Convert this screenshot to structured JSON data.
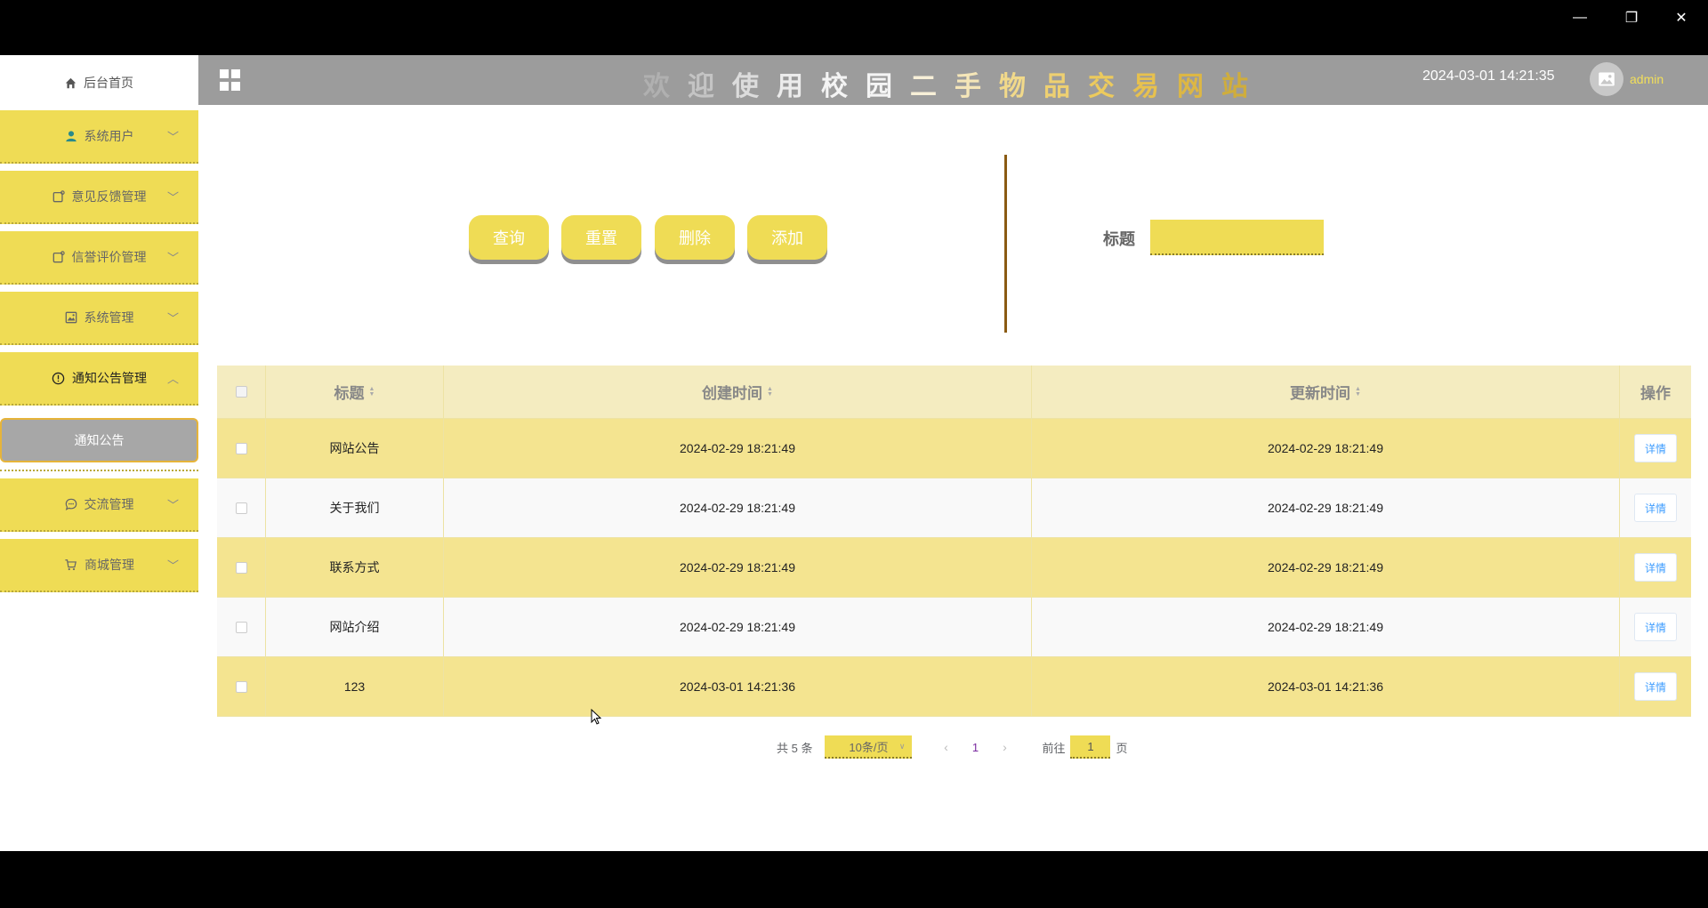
{
  "window": {
    "minimize": "—",
    "maximize": "❐",
    "close": "✕"
  },
  "sidebar": {
    "home": "后台首页",
    "menus": [
      {
        "label": "系统用户",
        "icon": "user-icon"
      },
      {
        "label": "意见反馈管理",
        "icon": "note-icon"
      },
      {
        "label": "信誉评价管理",
        "icon": "note-icon"
      },
      {
        "label": "系统管理",
        "icon": "image-icon"
      },
      {
        "label": "通知公告管理",
        "icon": "info-icon"
      },
      {
        "label": "交流管理",
        "icon": "chat-icon"
      },
      {
        "label": "商城管理",
        "icon": "cart-icon"
      }
    ],
    "submenu": {
      "label": "通知公告"
    }
  },
  "header": {
    "title_chars": [
      "欢",
      "迎",
      "使",
      "用",
      "校",
      "园",
      "二",
      "手",
      "物",
      "品",
      "交",
      "易",
      "网",
      "站"
    ],
    "title_colors": [
      "#b0b0b0",
      "#c4c4c4",
      "#dcdcdc",
      "#ececec",
      "#f4f4f4",
      "#f4f4f4",
      "#f8f0d8",
      "#f5e6b8",
      "#f1d98a",
      "#eed071",
      "#ecca5d",
      "#e7c14e",
      "#ddb744",
      "#cfad3c"
    ],
    "datetime": "2024-03-01 14:21:35",
    "username": "admin"
  },
  "search": {
    "buttons": {
      "query": "查询",
      "reset": "重置",
      "delete": "删除",
      "add": "添加"
    },
    "label": "标题",
    "placeholder": ""
  },
  "table": {
    "headers": {
      "title": "标题",
      "created": "创建时间",
      "updated": "更新时间",
      "op": "操作"
    },
    "rows": [
      {
        "title": "网站公告",
        "created": "2024-02-29 18:21:49",
        "updated": "2024-02-29 18:21:49",
        "op": "详情"
      },
      {
        "title": "关于我们",
        "created": "2024-02-29 18:21:49",
        "updated": "2024-02-29 18:21:49",
        "op": "详情"
      },
      {
        "title": "联系方式",
        "created": "2024-02-29 18:21:49",
        "updated": "2024-02-29 18:21:49",
        "op": "详情"
      },
      {
        "title": "网站介绍",
        "created": "2024-02-29 18:21:49",
        "updated": "2024-02-29 18:21:49",
        "op": "详情"
      },
      {
        "title": "123",
        "created": "2024-03-01 14:21:36",
        "updated": "2024-03-01 14:21:36",
        "op": "详情"
      }
    ]
  },
  "pagination": {
    "total": "共 5 条",
    "page_size": "10条/页",
    "current": "1",
    "goto_prefix": "前往",
    "goto_value": "1",
    "goto_suffix": "页"
  }
}
